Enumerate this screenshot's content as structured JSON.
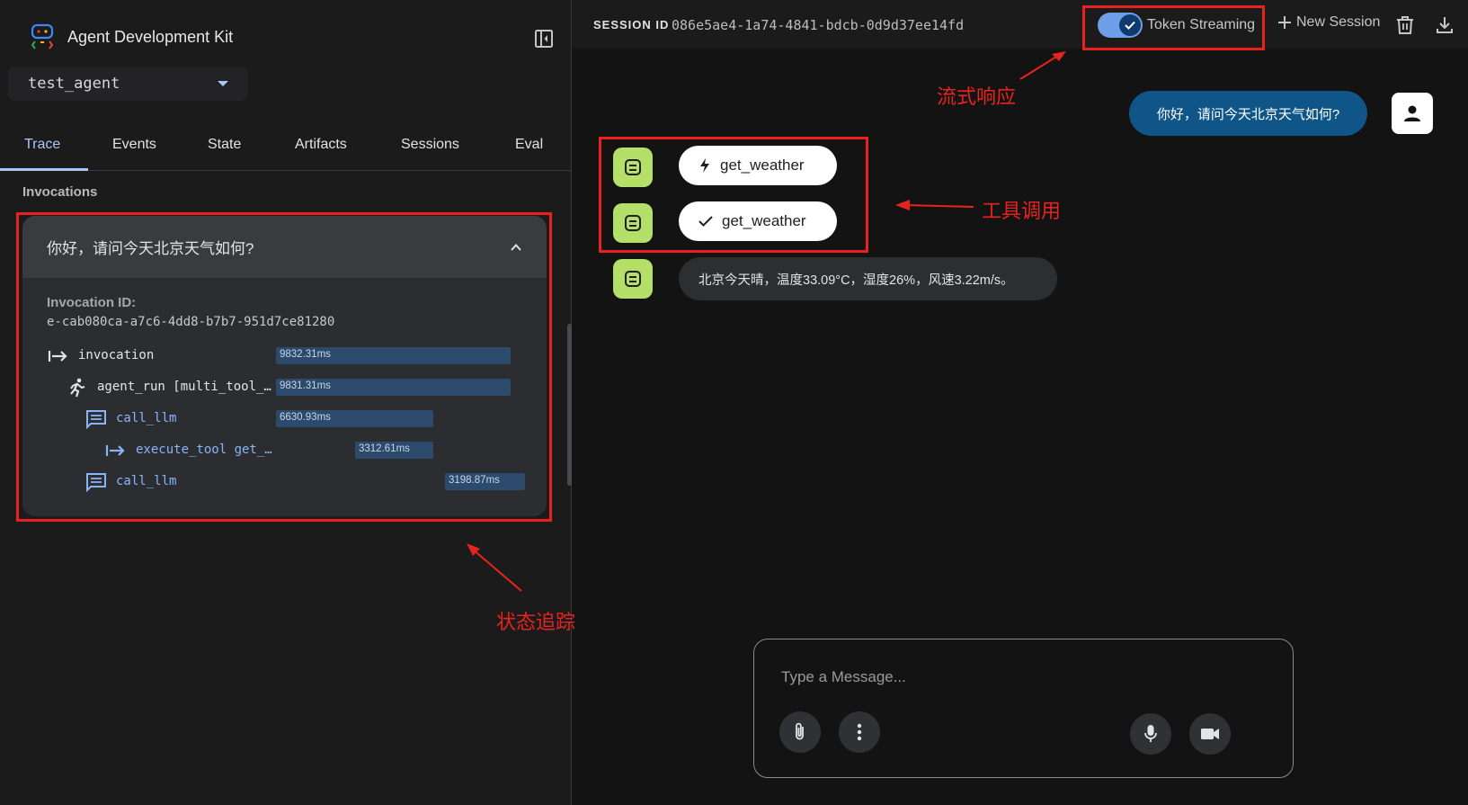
{
  "sidebar": {
    "brand_title": "Agent Development Kit",
    "agent_select_value": "test_agent",
    "tabs": [
      {
        "label": "Trace"
      },
      {
        "label": "Events"
      },
      {
        "label": "State"
      },
      {
        "label": "Artifacts"
      },
      {
        "label": "Sessions"
      },
      {
        "label": "Eval"
      }
    ],
    "active_tab": "Trace",
    "invocations_heading": "Invocations",
    "invocation": {
      "question": "你好，请问今天北京天气如何?",
      "id_label": "Invocation ID:",
      "id_value": "e-cab080ca-a7c6-4dd8-b7b7-951d7ce81280",
      "trace": [
        {
          "label": "invocation",
          "duration": "9832.31ms",
          "icon": "invocation-arrow-icon"
        },
        {
          "label": "agent_run [multi_tool_…",
          "duration": "9831.31ms",
          "icon": "running-person-icon"
        },
        {
          "label": "call_llm",
          "duration": "6630.93ms",
          "icon": "chat-icon"
        },
        {
          "label": "execute_tool get_…",
          "duration": "3312.61ms",
          "icon": "invocation-arrow-icon"
        },
        {
          "label": "call_llm",
          "duration": "3198.87ms",
          "icon": "chat-icon"
        }
      ]
    }
  },
  "topbar": {
    "session_label": "SESSION ID",
    "session_id": "086e5ae4-1a74-4841-bdcb-0d9d37ee14fd",
    "token_streaming_label": "Token Streaming",
    "token_streaming_on": true,
    "new_session_label": "New Session"
  },
  "chat": {
    "user_message": "你好，请问今天北京天气如何?",
    "tool_calls": [
      {
        "name": "get_weather",
        "icon": "bolt-icon"
      },
      {
        "name": "get_weather",
        "icon": "check-icon"
      }
    ],
    "bot_message": "北京今天晴，温度33.09°C，湿度26%，风速3.22m/s。"
  },
  "composer": {
    "placeholder": "Type a Message..."
  },
  "annotations": {
    "streaming": "流式响应",
    "tool_call": "工具调用",
    "state_trace": "状态追踪"
  },
  "colors": {
    "accent": "#a8c7fa",
    "annotation_red": "#e8231f",
    "bot_avatar": "#b4e06a",
    "user_bubble": "#0f5588"
  }
}
